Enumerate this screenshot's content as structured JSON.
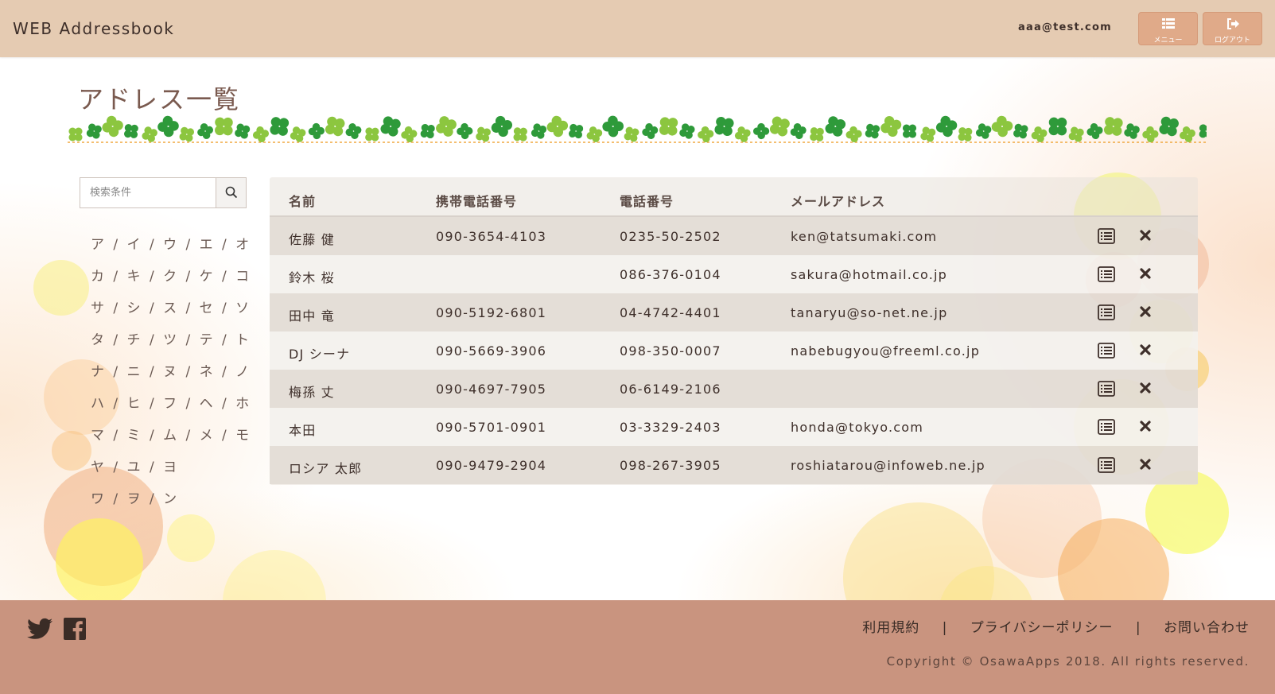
{
  "header": {
    "brand": "WEB Addressbook",
    "user_email": "aaa@test.com",
    "menu_label": "メニュー",
    "logout_label": "ログアウト"
  },
  "page_title": "アドレス一覧",
  "search": {
    "placeholder": "検索条件"
  },
  "kana_nav": [
    "ア / イ / ウ / エ / オ",
    "カ / キ / ク / ケ / コ",
    "サ / シ / ス / セ / ソ",
    "タ / チ / ツ / テ / ト",
    "ナ / ニ / ヌ / ネ / ノ",
    "ハ / ヒ / フ / ヘ / ホ",
    "マ / ミ / ム / メ / モ",
    "ヤ / ユ / ヨ",
    "ワ / ヲ / ン"
  ],
  "table": {
    "columns": [
      "名前",
      "携帯電話番号",
      "電話番号",
      "メールアドレス"
    ],
    "rows": [
      {
        "name": "佐藤 健",
        "mobile": "090-3654-4103",
        "tel": "0235-50-2502",
        "email": "ken@tatsumaki.com"
      },
      {
        "name": "鈴木 桜",
        "mobile": "",
        "tel": "086-376-0104",
        "email": "sakura@hotmail.co.jp"
      },
      {
        "name": "田中 竜",
        "mobile": "090-5192-6801",
        "tel": "04-4742-4401",
        "email": "tanaryu@so-net.ne.jp"
      },
      {
        "name": "DJ シーナ",
        "mobile": "090-5669-3906",
        "tel": "098-350-0007",
        "email": "nabebugyou@freeml.co.jp"
      },
      {
        "name": "梅孫 丈",
        "mobile": "090-4697-7905",
        "tel": "06-6149-2106",
        "email": ""
      },
      {
        "name": "本田",
        "mobile": "090-5701-0901",
        "tel": "03-3329-2403",
        "email": "honda@tokyo.com"
      },
      {
        "name": "ロシア 太郎",
        "mobile": "090-9479-2904",
        "tel": "098-267-3905",
        "email": "roshiatarou@infoweb.ne.jp"
      }
    ],
    "row_action_icons": [
      "detail-list-icon",
      "delete-x-icon"
    ]
  },
  "footer": {
    "social_icons": [
      "twitter-icon",
      "facebook-icon"
    ],
    "links": [
      "利用規約",
      "プライバシーポリシー",
      "お問い合わせ"
    ],
    "separator": "|",
    "copyright": "Copyright © OsawaApps 2018. All rights reserved."
  },
  "colors": {
    "header_bg": "#e5cbb2",
    "header_button_bg": "#e0aa89",
    "footer_bg": "#c9947f",
    "text_dark": "#3e2f2a",
    "clover_green": "#2e9a3a",
    "clover_light_green": "#8cc63f"
  }
}
